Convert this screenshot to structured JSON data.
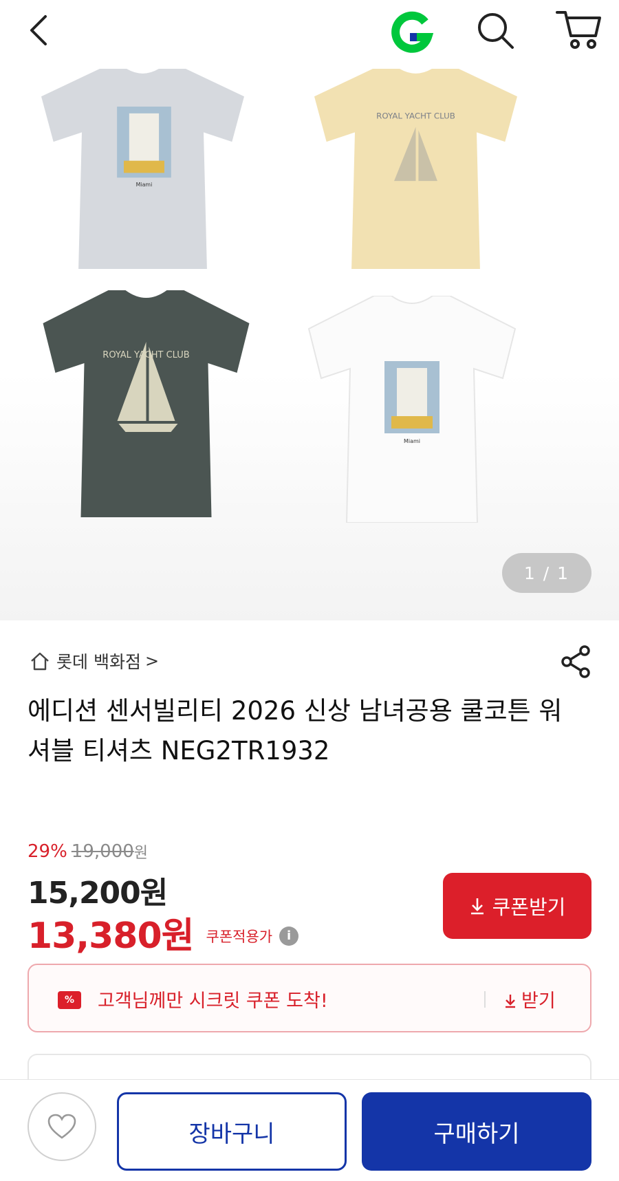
{
  "header": {
    "back_icon": "chevron-left-icon",
    "logo_icon": "g-logo-icon",
    "search_icon": "search-icon",
    "cart_icon": "cart-icon",
    "logo_color": "#00c73c"
  },
  "gallery": {
    "images": [
      {
        "color": "#d6d9de",
        "print": "hotel-building-graphic",
        "print_text": "Miami"
      },
      {
        "color": "#f2e1b2",
        "print": "yacht-club-graphic",
        "print_text": "ROYAL YACHT CLUB"
      },
      {
        "color": "#4b5552",
        "print": "yacht-club-graphic",
        "print_text": "ROYAL YACHT CLUB"
      },
      {
        "color": "#fbfbfb",
        "print": "hotel-building-graphic",
        "print_text": "Miami"
      }
    ],
    "page_indicator": "1 / 1"
  },
  "product": {
    "store_icon": "home-icon",
    "store_name": "롯데 백화점",
    "store_chevron": ">",
    "share_icon": "share-icon",
    "title": "에디션 센서빌리티 2026 신상 남녀공용 쿨코튼 워셔블 티셔츠 NEG2TR1932"
  },
  "price": {
    "discount_rate": "29%",
    "original_price": "19,000",
    "original_unit": "원",
    "sale_price": "15,200원",
    "coupon_price": "13,380원",
    "coupon_price_label": "쿠폰적용가",
    "info_icon": "info-icon",
    "coupon_button": "쿠폰받기",
    "accent_color": "#dc1f2a"
  },
  "secret_coupon": {
    "tag_icon": "coupon-icon",
    "tag_text": "%",
    "text": "고객님께만 시크릿 쿠폰 도착!",
    "get_label": "받기"
  },
  "bottom_bar": {
    "wish_icon": "heart-icon",
    "cart_label": "장바구니",
    "buy_label": "구매하기",
    "primary_color": "#1435a8"
  }
}
